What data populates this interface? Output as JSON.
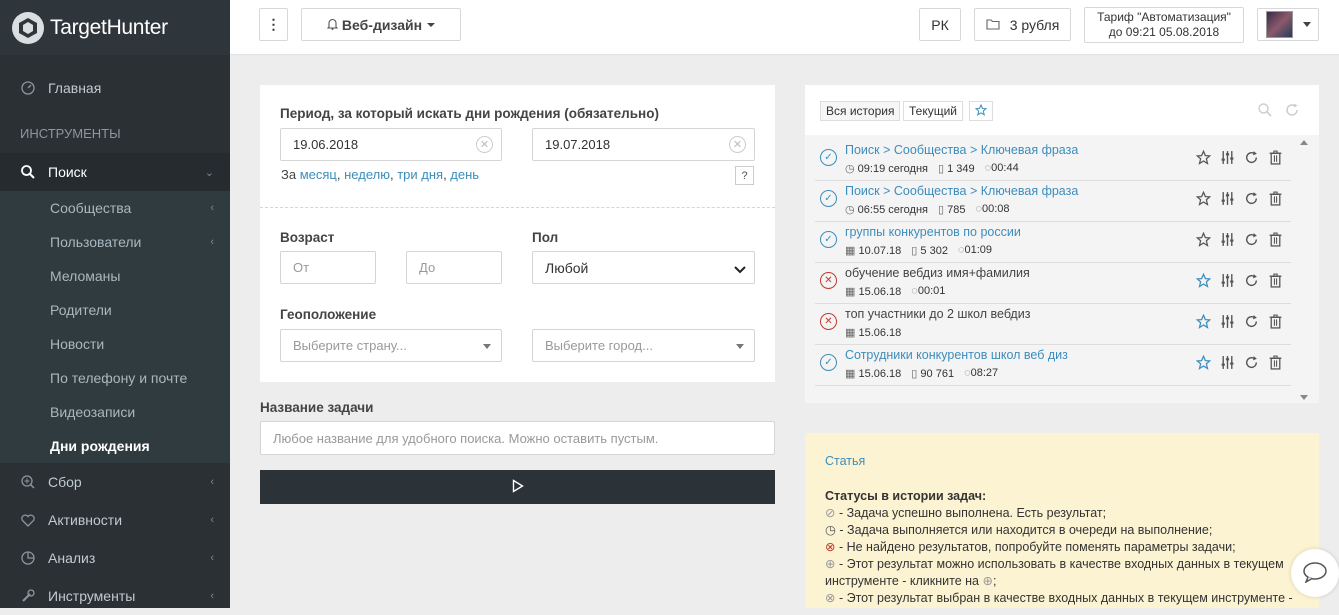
{
  "app": {
    "logo_text": "TargetHunter"
  },
  "sidebar": {
    "home": "Главная",
    "section_tools": "ИНСТРУМЕНТЫ",
    "search": "Поиск",
    "sub_items": [
      "Сообщества",
      "Пользователи",
      "Меломаны",
      "Родители",
      "Новости",
      "По телефону и почте",
      "Видеозаписи",
      "Дни рождения"
    ],
    "collect": "Сбор",
    "activity": "Активности",
    "analysis": "Анализ",
    "tools": "Инструменты"
  },
  "topbar": {
    "menu_dots": "⋮",
    "project": "Веб-дизайн",
    "region": "РК",
    "balance": "3 рубля",
    "tariff_line1": "Тариф \"Автоматизация\"",
    "tariff_line2": "до 09:21 05.08.2018"
  },
  "form": {
    "period_label": "Период, за который искать дни рождения (обязательно)",
    "date_from": "19.06.2018",
    "date_to": "19.07.2018",
    "quick_prefix": "За",
    "quick_links": [
      "месяц",
      "неделю",
      "три дня",
      "день"
    ],
    "help": "?",
    "age_label": "Возраст",
    "age_from_placeholder": "От",
    "age_to_placeholder": "До",
    "sex_label": "Пол",
    "sex_value": "Любой",
    "geo_label": "Геоположение",
    "country_placeholder": "Выберите страну...",
    "city_placeholder": "Выберите город...",
    "task_name_label": "Название задачи",
    "task_name_placeholder": "Любое название для удобного поиска. Можно оставить пустым."
  },
  "history": {
    "tab_all": "Вся история",
    "tab_current": "Текущий",
    "rows": [
      {
        "title": "Поиск > Сообщества > Ключевая фраза",
        "link": true,
        "status": "ok",
        "m1": "09:19 сегодня",
        "m2": "1 349",
        "m3": "00:44",
        "fav": false
      },
      {
        "title": "Поиск > Сообщества > Ключевая фраза",
        "link": true,
        "status": "ok",
        "m1": "06:55 сегодня",
        "m2": "785",
        "m3": "00:08",
        "fav": false
      },
      {
        "title": "группы конкурентов по россии",
        "link": true,
        "status": "ok",
        "m1": "10.07.18",
        "m2": "5 302",
        "m3": "01:09",
        "fav": false
      },
      {
        "title": "обучение вебдиз имя+фамилия",
        "link": false,
        "status": "err",
        "m1": "15.06.18",
        "m2": "",
        "m3": "00:01",
        "fav": true
      },
      {
        "title": "топ участники до 2 школ вебдиз",
        "link": false,
        "status": "err",
        "m1": "15.06.18",
        "m2": "",
        "m3": "",
        "fav": true
      },
      {
        "title": "Сотрудники конкурентов школ веб диз",
        "link": true,
        "status": "ok",
        "m1": "15.06.18",
        "m2": "90 761",
        "m3": "08:27",
        "fav": true
      }
    ]
  },
  "info": {
    "article_link": "Статья",
    "heading": "Статусы в истории задач:",
    "lines": [
      "- Задача успешно выполнена. Есть результат;",
      "- Задача выполняется или находится в очереди на выполнение;",
      "- Не найдено результатов, попробуйте поменять параметры задачи;",
      "- Этот результат можно использовать в качестве входных данных в текущем инструменте - кликните на",
      "- Этот результат выбран в качестве входных данных в текущем инструменте -"
    ],
    "line4_suffix": ";"
  },
  "colors": {
    "sidebar_bg": "#2a3034",
    "accent": "#3c8dbc",
    "run_button": "#2b3238",
    "info_bg": "#fcf3d2"
  }
}
